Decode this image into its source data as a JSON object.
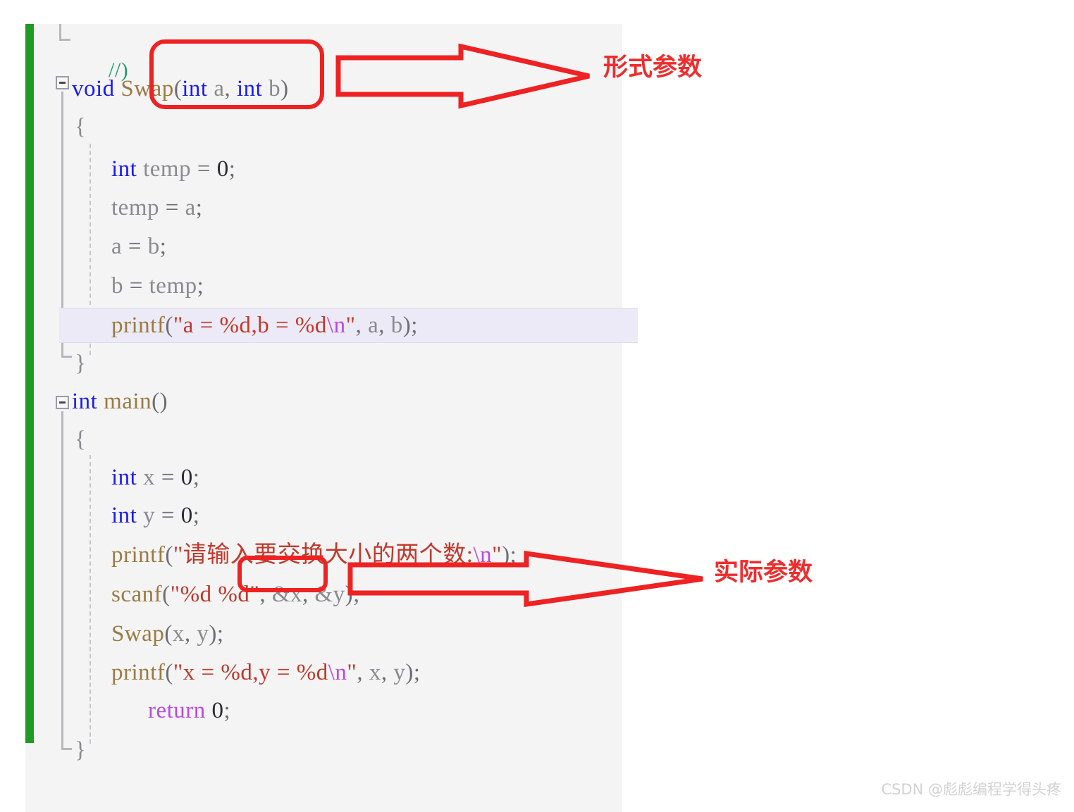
{
  "editor": {
    "background_color": "#f4f4f5",
    "change_bar_color": "#1f9b23",
    "highlight_line_color": "#eceaf6",
    "top_partial_line": "//)",
    "code_lines": [
      {
        "id": "swap-signature",
        "text": "void Swap(int a, int b)"
      },
      {
        "id": "swap-open-brace",
        "text": "{"
      },
      {
        "id": "decl-temp",
        "text": "int temp = 0;"
      },
      {
        "id": "assign-temp-a",
        "text": "temp = a;"
      },
      {
        "id": "assign-a-b",
        "text": "a = b;"
      },
      {
        "id": "assign-b-temp",
        "text": "b = temp;"
      },
      {
        "id": "printf-swap",
        "text": "printf(\"a = %d,b = %d\\n\", a, b);"
      },
      {
        "id": "swap-close-brace",
        "text": "}"
      },
      {
        "id": "main-signature",
        "text": "int main()"
      },
      {
        "id": "main-open-brace",
        "text": "{"
      },
      {
        "id": "decl-x",
        "text": "int x = 0;"
      },
      {
        "id": "decl-y",
        "text": "int y = 0;"
      },
      {
        "id": "printf-prompt",
        "text": "printf(\"请输入要交换大小的两个数:\\n\");"
      },
      {
        "id": "scanf-xy",
        "text": "scanf(\"%d %d\", &x, &y);"
      },
      {
        "id": "call-swap",
        "text": "Swap(x, y);"
      },
      {
        "id": "printf-result",
        "text": "printf(\"x = %d,y = %d\\n\", x, y);"
      },
      {
        "id": "return-zero",
        "text": "return 0;"
      },
      {
        "id": "main-close-brace",
        "text": "}"
      }
    ]
  },
  "annotations": {
    "color": "#ee2d2d",
    "formal": {
      "label": "形式参数",
      "target_text": "(int a, int b)"
    },
    "actual": {
      "label": "实际参数",
      "target_text": "&x, &y);"
    }
  },
  "watermark": {
    "text": "CSDN @彪彪编程学得头疼"
  }
}
